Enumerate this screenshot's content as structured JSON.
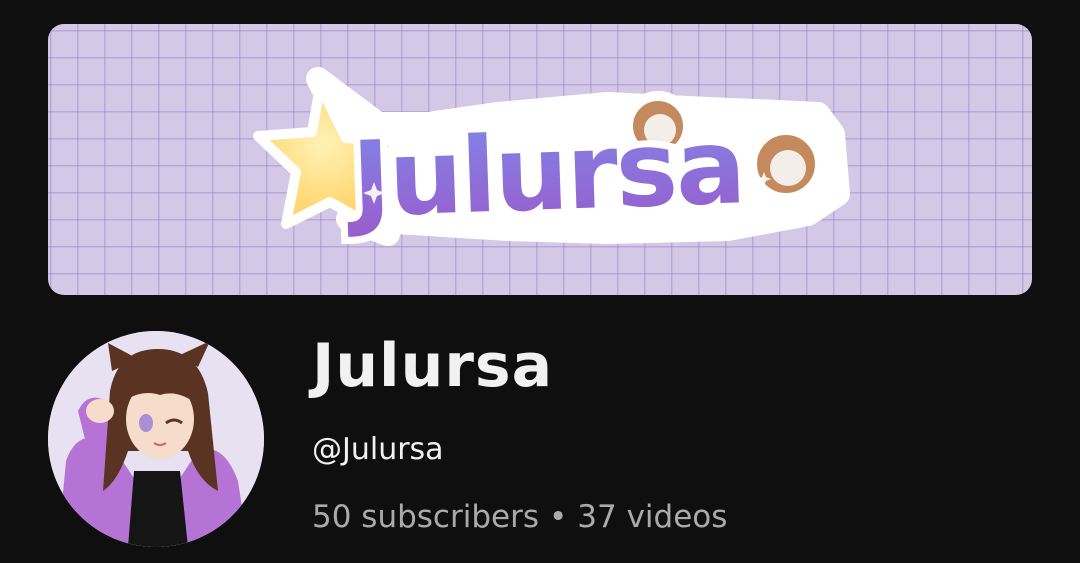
{
  "banner": {
    "logo_text": "Julursa",
    "colors": {
      "background": "#d3c9e6",
      "grid": "#9682c8",
      "star": "#ffd66b",
      "letters_top": "#7f86e8",
      "letters_bottom": "#9a5ccc",
      "ears": "#c48a5e"
    }
  },
  "channel": {
    "name": "Julursa",
    "handle": "@Julursa",
    "subscribers": "50 subscribers",
    "separator": "•",
    "videos": "37 videos"
  },
  "avatar": {
    "icon": "vtuber-avatar-icon",
    "colors": {
      "hair": "#5a3322",
      "hoodie": "#b673d6",
      "top": "#151515",
      "skin": "#f6dccb",
      "eye": "#a98fd8"
    }
  },
  "theme": {
    "page_background": "#0f0f0f",
    "primary_text": "#f1f1f1",
    "secondary_text": "#aaaaaa"
  }
}
